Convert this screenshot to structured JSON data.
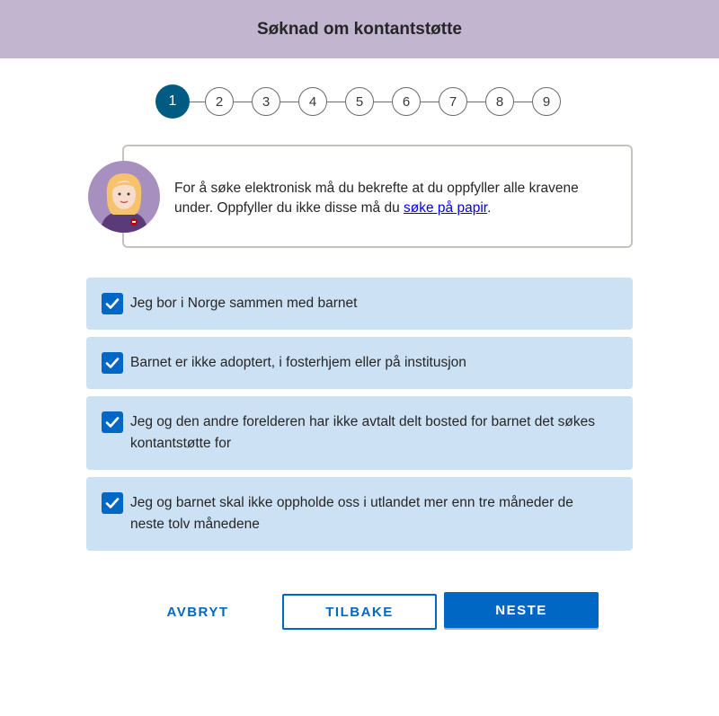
{
  "header": {
    "title": "Søknad om kontantstøtte"
  },
  "stepper": {
    "current": 1,
    "steps": [
      "1",
      "2",
      "3",
      "4",
      "5",
      "6",
      "7",
      "8",
      "9"
    ]
  },
  "intro": {
    "text_before_link": "For å søke elektronisk må du bekrefte at du oppfyller alle kravene under. Oppfyller du ikke disse må du ",
    "link_text": "søke på papir",
    "text_after_link": "."
  },
  "requirements": [
    {
      "label": "Jeg bor i Norge sammen med barnet",
      "checked": true
    },
    {
      "label": "Barnet er ikke adoptert, i fosterhjem eller på institusjon",
      "checked": true
    },
    {
      "label": "Jeg og den andre forelderen har ikke avtalt delt bosted for barnet det søkes kontantstøtte for",
      "checked": true
    },
    {
      "label": "Jeg og barnet skal ikke oppholde oss i utlandet mer enn tre måneder de neste tolv månedene",
      "checked": true
    }
  ],
  "buttons": {
    "cancel": "AVBRYT",
    "back": "TILBAKE",
    "next": "NESTE"
  },
  "colors": {
    "header_bg": "#c1b5d0",
    "active_step": "#005b82",
    "item_bg": "#cce1f3",
    "primary": "#0067c5"
  }
}
